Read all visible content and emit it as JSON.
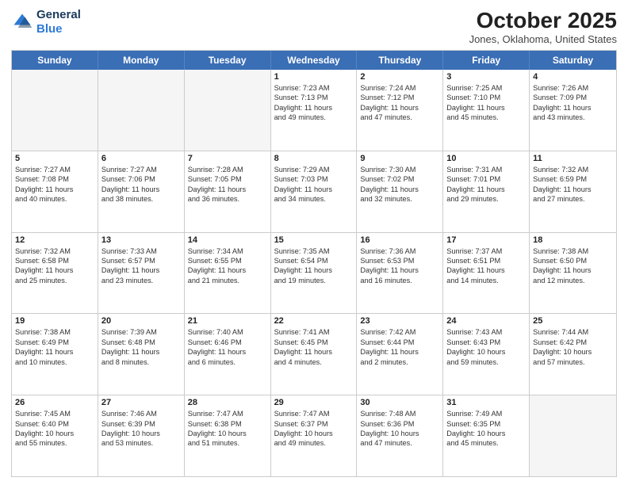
{
  "header": {
    "logo_line1": "General",
    "logo_line2": "Blue",
    "title": "October 2025",
    "subtitle": "Jones, Oklahoma, United States"
  },
  "weekdays": [
    "Sunday",
    "Monday",
    "Tuesday",
    "Wednesday",
    "Thursday",
    "Friday",
    "Saturday"
  ],
  "rows": [
    [
      {
        "day": "",
        "info": ""
      },
      {
        "day": "",
        "info": ""
      },
      {
        "day": "",
        "info": ""
      },
      {
        "day": "1",
        "info": "Sunrise: 7:23 AM\nSunset: 7:13 PM\nDaylight: 11 hours\nand 49 minutes."
      },
      {
        "day": "2",
        "info": "Sunrise: 7:24 AM\nSunset: 7:12 PM\nDaylight: 11 hours\nand 47 minutes."
      },
      {
        "day": "3",
        "info": "Sunrise: 7:25 AM\nSunset: 7:10 PM\nDaylight: 11 hours\nand 45 minutes."
      },
      {
        "day": "4",
        "info": "Sunrise: 7:26 AM\nSunset: 7:09 PM\nDaylight: 11 hours\nand 43 minutes."
      }
    ],
    [
      {
        "day": "5",
        "info": "Sunrise: 7:27 AM\nSunset: 7:08 PM\nDaylight: 11 hours\nand 40 minutes."
      },
      {
        "day": "6",
        "info": "Sunrise: 7:27 AM\nSunset: 7:06 PM\nDaylight: 11 hours\nand 38 minutes."
      },
      {
        "day": "7",
        "info": "Sunrise: 7:28 AM\nSunset: 7:05 PM\nDaylight: 11 hours\nand 36 minutes."
      },
      {
        "day": "8",
        "info": "Sunrise: 7:29 AM\nSunset: 7:03 PM\nDaylight: 11 hours\nand 34 minutes."
      },
      {
        "day": "9",
        "info": "Sunrise: 7:30 AM\nSunset: 7:02 PM\nDaylight: 11 hours\nand 32 minutes."
      },
      {
        "day": "10",
        "info": "Sunrise: 7:31 AM\nSunset: 7:01 PM\nDaylight: 11 hours\nand 29 minutes."
      },
      {
        "day": "11",
        "info": "Sunrise: 7:32 AM\nSunset: 6:59 PM\nDaylight: 11 hours\nand 27 minutes."
      }
    ],
    [
      {
        "day": "12",
        "info": "Sunrise: 7:32 AM\nSunset: 6:58 PM\nDaylight: 11 hours\nand 25 minutes."
      },
      {
        "day": "13",
        "info": "Sunrise: 7:33 AM\nSunset: 6:57 PM\nDaylight: 11 hours\nand 23 minutes."
      },
      {
        "day": "14",
        "info": "Sunrise: 7:34 AM\nSunset: 6:55 PM\nDaylight: 11 hours\nand 21 minutes."
      },
      {
        "day": "15",
        "info": "Sunrise: 7:35 AM\nSunset: 6:54 PM\nDaylight: 11 hours\nand 19 minutes."
      },
      {
        "day": "16",
        "info": "Sunrise: 7:36 AM\nSunset: 6:53 PM\nDaylight: 11 hours\nand 16 minutes."
      },
      {
        "day": "17",
        "info": "Sunrise: 7:37 AM\nSunset: 6:51 PM\nDaylight: 11 hours\nand 14 minutes."
      },
      {
        "day": "18",
        "info": "Sunrise: 7:38 AM\nSunset: 6:50 PM\nDaylight: 11 hours\nand 12 minutes."
      }
    ],
    [
      {
        "day": "19",
        "info": "Sunrise: 7:38 AM\nSunset: 6:49 PM\nDaylight: 11 hours\nand 10 minutes."
      },
      {
        "day": "20",
        "info": "Sunrise: 7:39 AM\nSunset: 6:48 PM\nDaylight: 11 hours\nand 8 minutes."
      },
      {
        "day": "21",
        "info": "Sunrise: 7:40 AM\nSunset: 6:46 PM\nDaylight: 11 hours\nand 6 minutes."
      },
      {
        "day": "22",
        "info": "Sunrise: 7:41 AM\nSunset: 6:45 PM\nDaylight: 11 hours\nand 4 minutes."
      },
      {
        "day": "23",
        "info": "Sunrise: 7:42 AM\nSunset: 6:44 PM\nDaylight: 11 hours\nand 2 minutes."
      },
      {
        "day": "24",
        "info": "Sunrise: 7:43 AM\nSunset: 6:43 PM\nDaylight: 10 hours\nand 59 minutes."
      },
      {
        "day": "25",
        "info": "Sunrise: 7:44 AM\nSunset: 6:42 PM\nDaylight: 10 hours\nand 57 minutes."
      }
    ],
    [
      {
        "day": "26",
        "info": "Sunrise: 7:45 AM\nSunset: 6:40 PM\nDaylight: 10 hours\nand 55 minutes."
      },
      {
        "day": "27",
        "info": "Sunrise: 7:46 AM\nSunset: 6:39 PM\nDaylight: 10 hours\nand 53 minutes."
      },
      {
        "day": "28",
        "info": "Sunrise: 7:47 AM\nSunset: 6:38 PM\nDaylight: 10 hours\nand 51 minutes."
      },
      {
        "day": "29",
        "info": "Sunrise: 7:47 AM\nSunset: 6:37 PM\nDaylight: 10 hours\nand 49 minutes."
      },
      {
        "day": "30",
        "info": "Sunrise: 7:48 AM\nSunset: 6:36 PM\nDaylight: 10 hours\nand 47 minutes."
      },
      {
        "day": "31",
        "info": "Sunrise: 7:49 AM\nSunset: 6:35 PM\nDaylight: 10 hours\nand 45 minutes."
      },
      {
        "day": "",
        "info": ""
      }
    ]
  ]
}
